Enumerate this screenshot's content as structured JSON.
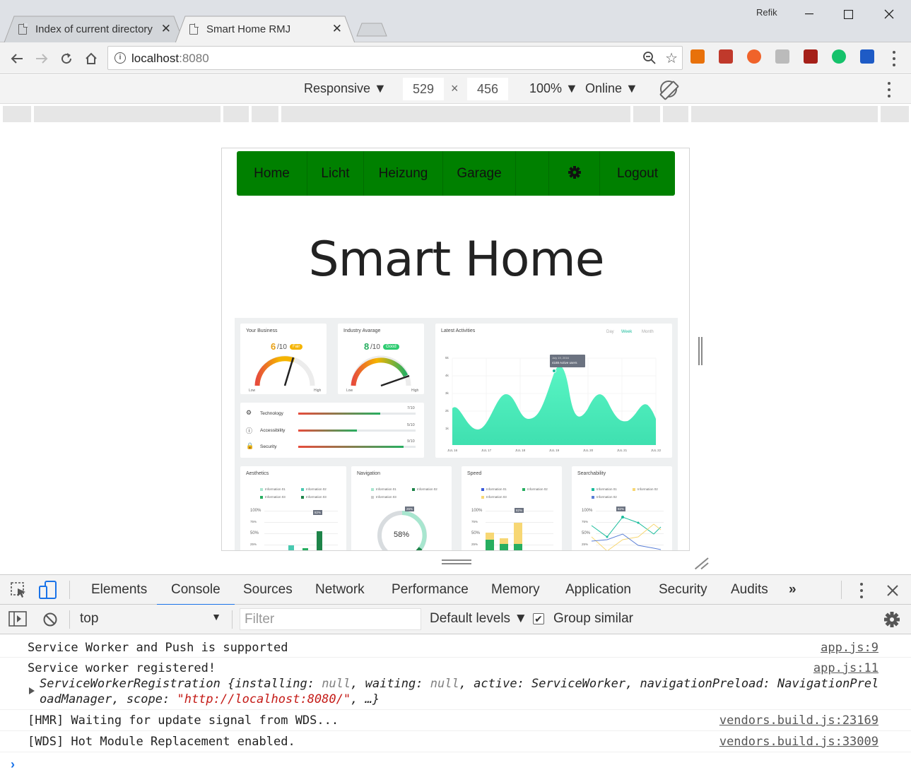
{
  "browser": {
    "tabs": [
      {
        "title": "Index of current directory",
        "active": false
      },
      {
        "title": "Smart Home RMJ",
        "active": true
      }
    ],
    "profile": "Refik",
    "address": {
      "host": "localhost",
      "port": ":8080"
    },
    "extension_colors": [
      "#e8710a",
      "#c0392b",
      "#f0632a",
      "#bbbbbb",
      "#a52019",
      "#15c26b",
      "#1e5bc6"
    ]
  },
  "device_toolbar": {
    "mode": "Responsive ▼",
    "width": "529",
    "times": "×",
    "height": "456",
    "zoom": "100% ▼",
    "network": "Online ▼"
  },
  "app": {
    "nav": [
      "Home",
      "Licht",
      "Heizung",
      "Garage"
    ],
    "logout": "Logout",
    "title": "Smart Home",
    "nav_color": "#008000",
    "dashboard": {
      "your_business": {
        "title": "Your Business",
        "score": "6",
        "of": "/10",
        "badge": "Fair",
        "low": "Low",
        "high": "High"
      },
      "industry": {
        "title": "Industry Avarage",
        "score": "8",
        "of": "/10",
        "badge": "Good",
        "low": "Low",
        "high": "High"
      },
      "metrics": [
        {
          "label": "Technology",
          "value": "7/10",
          "fill": 0.7
        },
        {
          "label": "Accessibility",
          "value": "5/10",
          "fill": 0.5
        },
        {
          "label": "Security",
          "value": "9/10",
          "fill": 0.9
        }
      ],
      "activities": {
        "title": "Latest Activities",
        "filters": [
          "Day",
          "Week",
          "Month"
        ],
        "tooltip_date": "July 19, 2016",
        "tooltip_value": "4188 Active users",
        "y_ticks": [
          "5k",
          "4k",
          "3k",
          "2k",
          "1k"
        ],
        "x_ticks": [
          "JUL 16",
          "JUL 17",
          "JUL 18",
          "JUL 19",
          "JUL 20",
          "JUL 21",
          "JUL 22"
        ]
      },
      "small_cards": [
        {
          "title": "Aesthetics",
          "legend": [
            "Information 01",
            "Information 02",
            "Information 03",
            "Information 03"
          ],
          "badge": "82%"
        },
        {
          "title": "Navigation",
          "legend": [
            "Information 01",
            "Information 02",
            "Information 03"
          ],
          "badge": "26%",
          "center": "58%"
        },
        {
          "title": "Speed",
          "legend": [
            "Information 01",
            "Information 02",
            "Information 03"
          ],
          "badge": "82%"
        },
        {
          "title": "Searchability",
          "legend": [
            "Information 01",
            "Information 02",
            "Information 02"
          ],
          "badge": "82%"
        }
      ],
      "pct_ticks": [
        "100%",
        "75%",
        "50%",
        "25%"
      ]
    }
  },
  "devtools": {
    "tabs": [
      "Elements",
      "Console",
      "Sources",
      "Network",
      "Performance",
      "Memory",
      "Application",
      "Security",
      "Audits"
    ],
    "more": "»",
    "context": "top",
    "filter_placeholder": "Filter",
    "levels": "Default levels ▼",
    "group_similar": "Group similar",
    "messages": [
      {
        "text": "Service Worker and Push is supported",
        "source": "app.js:9"
      },
      {
        "text": "Service worker registered!",
        "source": "app.js:11"
      },
      {
        "text": "[HMR] Waiting for update signal from WDS...",
        "source": "vendors.build.js:23169"
      },
      {
        "text": "[WDS] Hot Module Replacement enabled.",
        "source": "vendors.build.js:33009"
      }
    ],
    "object": {
      "name": "ServiceWorkerRegistration ",
      "open": "{",
      "k1": "installing: ",
      "v1": "null",
      "k2": ", waiting: ",
      "v2": "null",
      "k3": ", active: ServiceWorker, navigationPreload: NavigationPrel",
      "line2a": "oadManager, scope: ",
      "scope": "\"http://localhost:8080/\"",
      "line2b": ", …}"
    },
    "prompt": "›"
  }
}
